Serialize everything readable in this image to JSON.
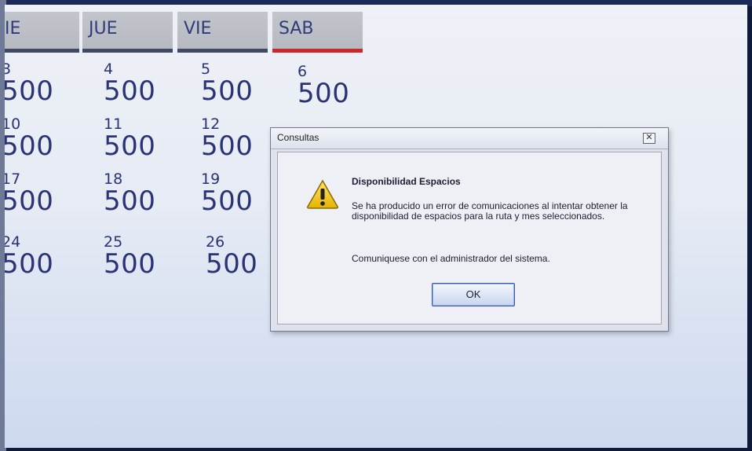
{
  "calendar": {
    "headers": [
      {
        "label": "IE"
      },
      {
        "label": "JUE"
      },
      {
        "label": "VIE"
      },
      {
        "label": "SAB",
        "active": true
      }
    ],
    "rows": [
      [
        {
          "day": "3",
          "value": "500"
        },
        {
          "day": "4",
          "value": "500"
        },
        {
          "day": "5",
          "value": "500"
        },
        {
          "day": "6",
          "value": "500"
        }
      ],
      [
        {
          "day": "10",
          "value": "500"
        },
        {
          "day": "11",
          "value": "500"
        },
        {
          "day": "12",
          "value": "500"
        }
      ],
      [
        {
          "day": "17",
          "value": "500"
        },
        {
          "day": "18",
          "value": "500"
        },
        {
          "day": "19",
          "value": "500"
        }
      ],
      [
        {
          "day": "24",
          "value": "500"
        },
        {
          "day": "25",
          "value": "500"
        },
        {
          "day": "26",
          "value": "500"
        }
      ]
    ]
  },
  "dialog": {
    "title": "Consultas",
    "close_glyph": "✕",
    "heading": "Disponibilidad Espacios",
    "message": "Se ha producido un error de comunicaciones al intentar obtener la disponibilidad de espacios para la ruta y mes seleccionados.",
    "help": "Comuniquese con el administrador del sistema.",
    "ok_label": "OK",
    "icon": "warning-icon"
  },
  "colors": {
    "active_tab_bar": "#cc2a2a",
    "tab_bar": "#3e4a63",
    "calendar_text": "#2a3475"
  }
}
